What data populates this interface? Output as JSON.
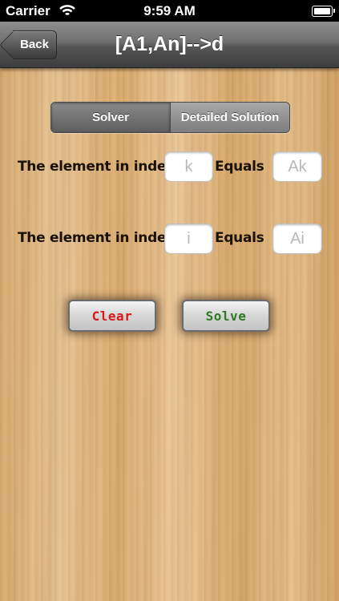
{
  "status_bar": {
    "carrier": "Carrier",
    "time": "9:59 AM",
    "wifi_icon": "wifi-icon",
    "battery_icon": "battery-icon"
  },
  "nav": {
    "back_label": "Back",
    "title": "[A1,An]-->d"
  },
  "segments": {
    "solver": "Solver",
    "detailed": "Detailed Solution",
    "selected": "Solver"
  },
  "rows": [
    {
      "label": "The element in index",
      "index_placeholder": "k",
      "equals": "Equals",
      "value_placeholder": "Ak"
    },
    {
      "label": "The element in index",
      "index_placeholder": "i",
      "equals": "Equals",
      "value_placeholder": "Ai"
    }
  ],
  "buttons": {
    "clear": "Clear",
    "solve": "Solve"
  },
  "colors": {
    "clear_text": "#d91818",
    "solve_text": "#2d7a22",
    "nav_bar": "#5a5a5a",
    "background": "#e0b780"
  }
}
